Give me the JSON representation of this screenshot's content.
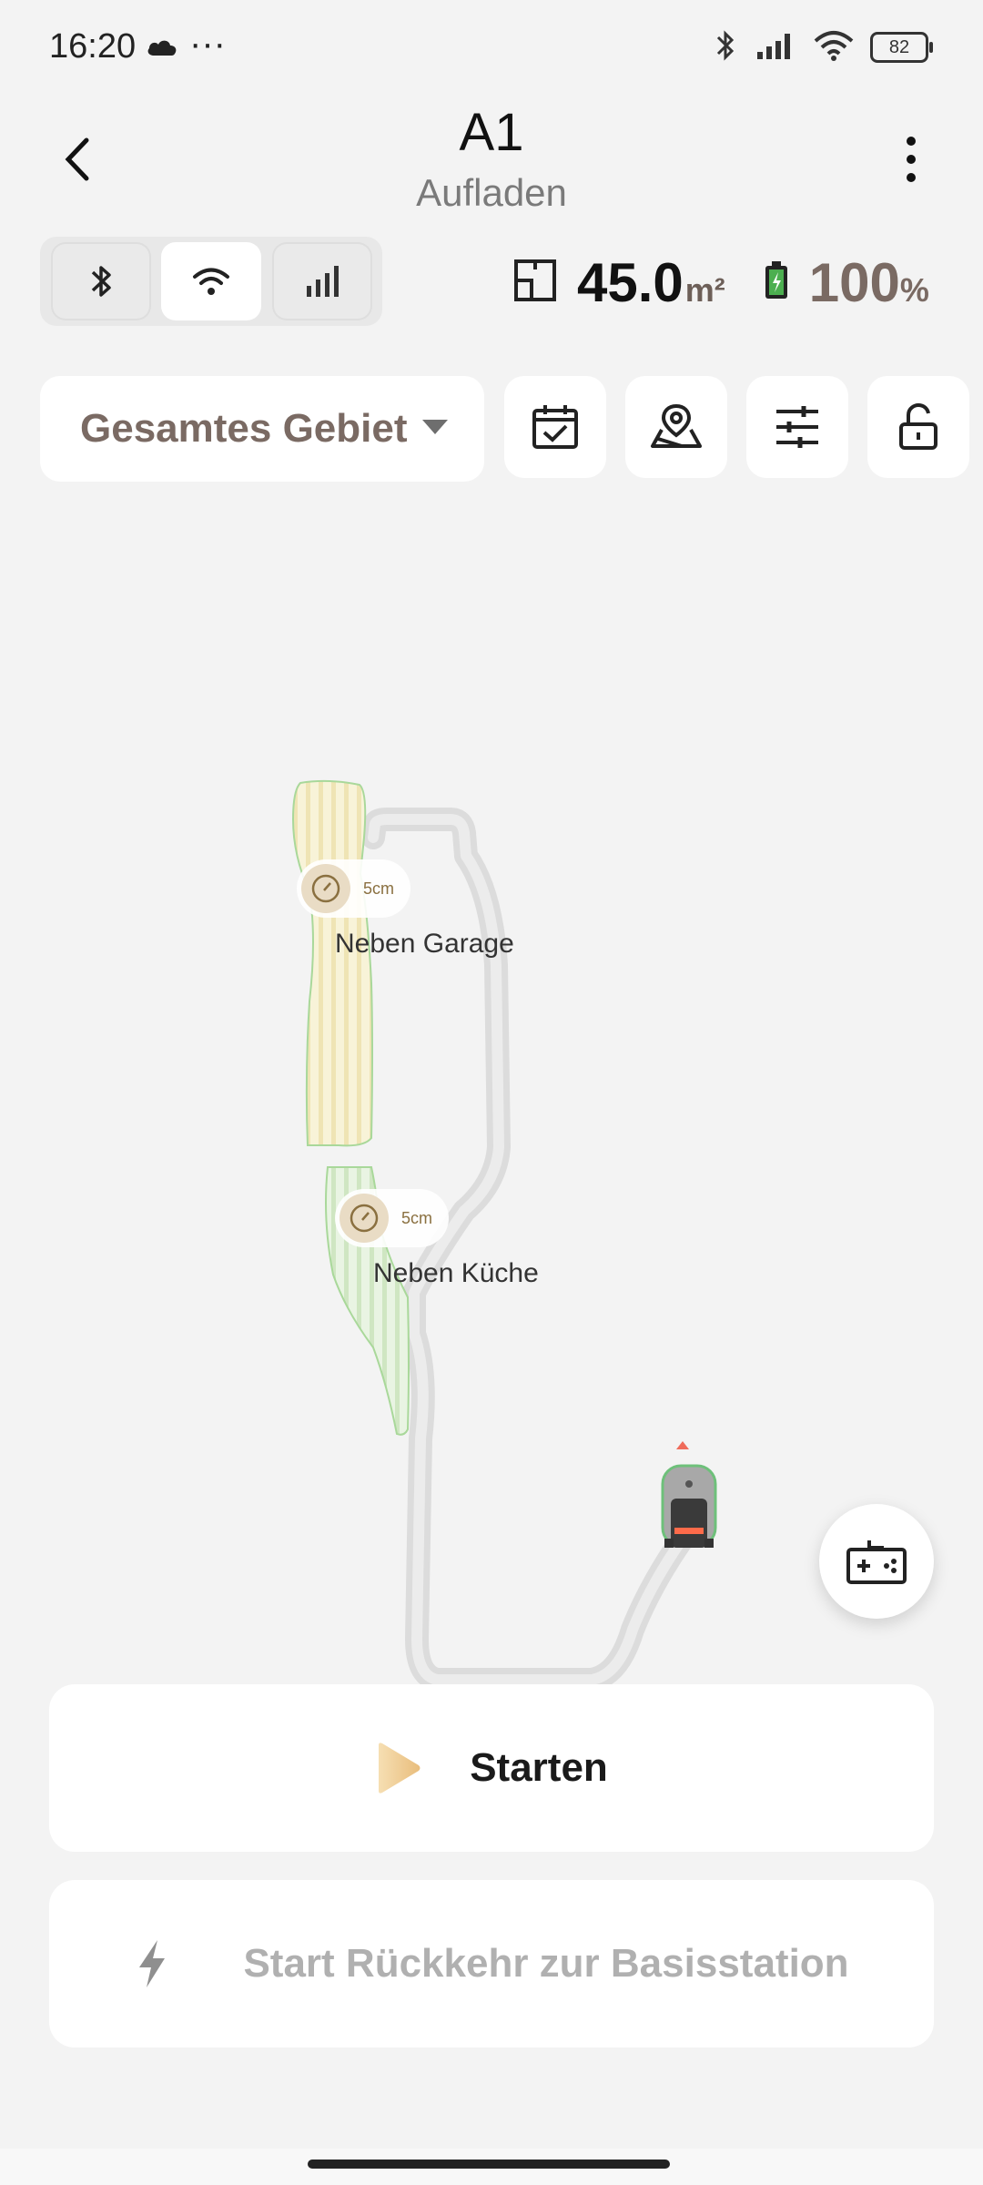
{
  "status_bar": {
    "time": "16:20",
    "dots": "···",
    "battery_level": "82"
  },
  "header": {
    "title": "A1",
    "subtitle": "Aufladen"
  },
  "stats": {
    "area_value": "45.0",
    "area_unit": "m²",
    "battery_value": "100",
    "battery_unit": "%"
  },
  "toolbar": {
    "zone_selector_label": "Gesamtes Gebiet"
  },
  "map": {
    "zones": [
      {
        "name": "Neben Garage",
        "cut_height": "5cm",
        "color": "#f7f0cf"
      },
      {
        "name": "Neben Küche",
        "cut_height": "5cm",
        "color": "#e3f1dc"
      }
    ]
  },
  "actions": {
    "start_label": "Starten",
    "return_label": "Start Rückkehr zur Basisstation"
  },
  "colors": {
    "accent_brown": "#7a6a63",
    "play_icon": "#f0c98a",
    "path_gray": "#dcdcdc"
  }
}
